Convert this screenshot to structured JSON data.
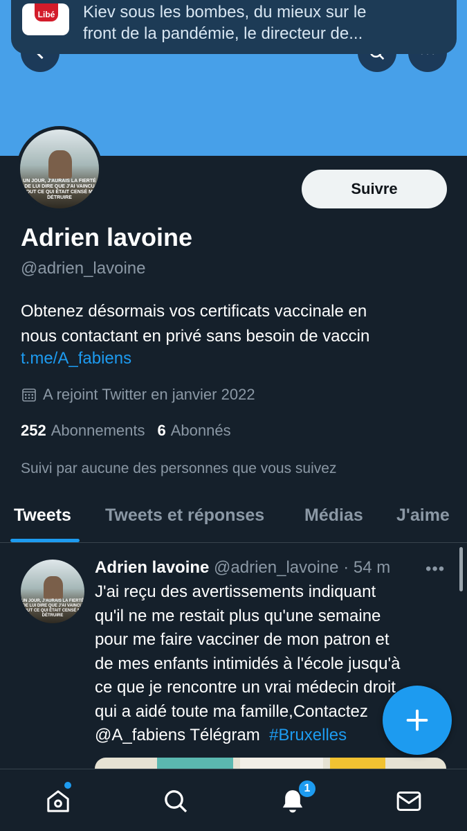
{
  "notification": {
    "app": "Libé",
    "text_line1": "Kiev sous les bombes, du mieux sur le",
    "text_line2": "front de la pandémie, le directeur de..."
  },
  "header": {
    "back_icon": "chevron-left-icon",
    "search_icon": "search-icon",
    "more_icon": "more-icon",
    "banner_color": "#47a0e9"
  },
  "profile": {
    "avatar_caption": "UN JOUR, J'AURAIS LA FIERTÉ DE LUI DIRE QUE J'AI VAINCU TOUT CE QUI ÉTAIT CENSÉ ME DÉTRUIRE",
    "follow_label": "Suivre",
    "name": "Adrien lavoine",
    "handle": "@adrien_lavoine",
    "bio_line1": "Obtenez désormais vos certificats vaccinale en",
    "bio_line2": "nous contactant en privé sans besoin de vaccin",
    "bio_link": "t.me/A_fabiens",
    "joined": "A rejoint Twitter en janvier 2022",
    "following_count": "252",
    "following_label": "Abonnements",
    "followers_count": "6",
    "followers_label": "Abonnés",
    "followed_by": "Suivi par aucune des personnes que vous suivez"
  },
  "tabs": [
    {
      "label": "Tweets",
      "active": true
    },
    {
      "label": "Tweets et réponses",
      "active": false
    },
    {
      "label": "Médias",
      "active": false
    },
    {
      "label": "J'aime",
      "active": false
    }
  ],
  "tweet": {
    "name": "Adrien lavoine",
    "handle": "@adrien_lavoine",
    "separator": "·",
    "time": "54 m",
    "more": "•••",
    "lines": [
      "J'ai reçu des avertissements indiquant",
      "qu'il ne me restait plus qu'une semaine",
      "pour me faire vacciner de mon patron et",
      "de mes enfants intimidés à l'école jusqu'à",
      "ce que je rencontre un vrai médecin droit",
      "qui a aidé toute ma famille,Contactez"
    ],
    "mention": "@A_fabiens Télégram",
    "hashtag": "#Bruxelles"
  },
  "fab": {
    "icon": "plus-icon"
  },
  "bottom_nav": {
    "home_icon": "home-icon",
    "search_icon": "search-icon",
    "notifications_icon": "bell-icon",
    "notifications_badge": "1",
    "messages_icon": "mail-icon"
  },
  "colors": {
    "background": "#15202b",
    "accent": "#1d9bf0",
    "secondary_text": "#8b98a5"
  }
}
